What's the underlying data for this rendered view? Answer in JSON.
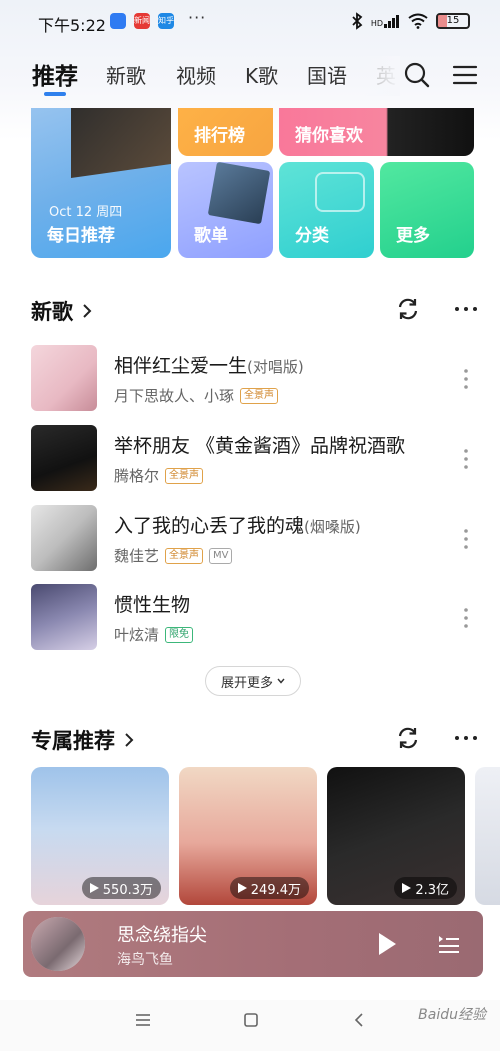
{
  "status_bar": {
    "time": "下午5:22",
    "apps": [
      {
        "name": "message-app-icon",
        "color": "#2f7bf2",
        "text": ""
      },
      {
        "name": "news-app-icon",
        "color": "#e53935",
        "text": "新闻"
      },
      {
        "name": "zhihu-app-icon",
        "color": "#1e88e5",
        "text": "知乎"
      }
    ],
    "more": "···",
    "network": "HD",
    "battery": "15"
  },
  "tabs": [
    {
      "label": "推荐",
      "active": true
    },
    {
      "label": "新歌"
    },
    {
      "label": "视频"
    },
    {
      "label": "K歌"
    },
    {
      "label": "国语"
    },
    {
      "label": "英"
    }
  ],
  "grid": {
    "daily": {
      "date": "Oct 12 周四",
      "label": "每日推荐"
    },
    "ranking": {
      "label": "排行榜"
    },
    "guess": {
      "label": "猜你喜欢"
    },
    "playlist": {
      "label": "歌单"
    },
    "category": {
      "label": "分类"
    },
    "more": {
      "label": "更多"
    }
  },
  "new_songs": {
    "title": "新歌",
    "songs": [
      {
        "title": "相伴红尘爱一生",
        "version": "(对唱版)",
        "artist": "月下思故人、小琢",
        "badges": [
          "全景声"
        ]
      },
      {
        "title": "举杯朋友 《黄金酱酒》品牌祝酒歌",
        "version": "",
        "artist": "腾格尔",
        "badges": [
          "全景声"
        ]
      },
      {
        "title": "入了我的心丢了我的魂",
        "version": "(烟嗓版)",
        "artist": "魏佳艺",
        "badges": [
          "全景声",
          "MV"
        ]
      },
      {
        "title": "惯性生物",
        "version": "",
        "artist": "叶炫清",
        "badges": [
          "限免"
        ]
      }
    ],
    "expand_label": "展开更多"
  },
  "exclusive": {
    "title": "专属推荐",
    "cards": [
      {
        "plays": "550.3万"
      },
      {
        "plays": "249.4万"
      },
      {
        "plays": "2.3亿"
      }
    ]
  },
  "player": {
    "title": "思念绕指尖",
    "artist": "海鸟飞鱼"
  },
  "watermark": "Baidu经验"
}
